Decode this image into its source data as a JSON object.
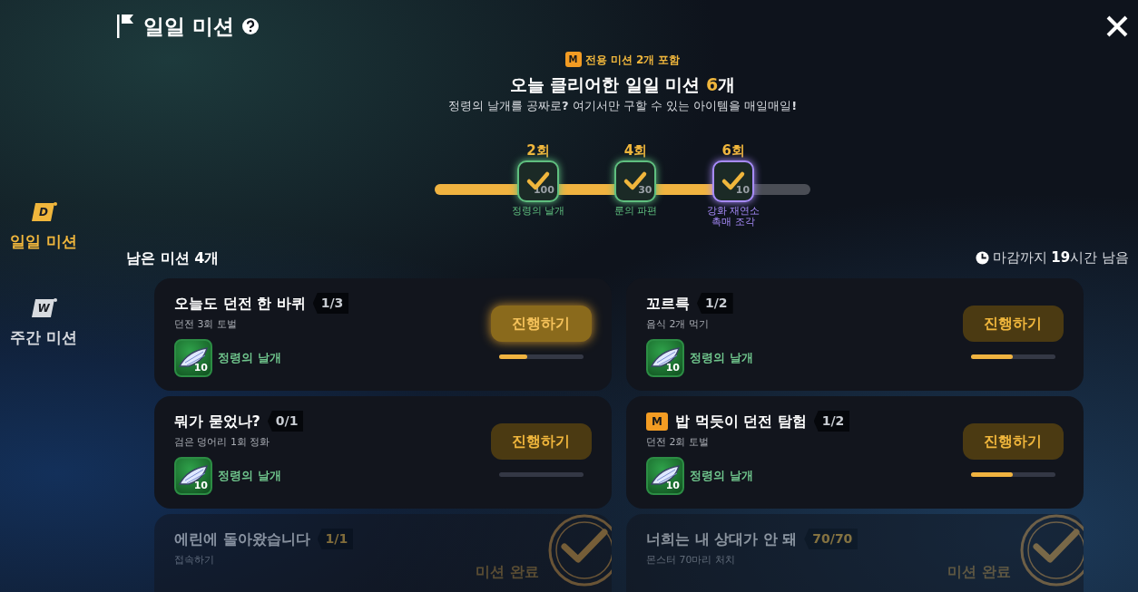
{
  "header": {
    "title": "일일 미션"
  },
  "sidebar": {
    "items": [
      {
        "label": "일일 미션",
        "letter": "D",
        "selected": true
      },
      {
        "label": "주간 미션",
        "letter": "W",
        "selected": false
      }
    ]
  },
  "summary": {
    "badge": "M",
    "note": "전용 미션 2개 포함",
    "title": "오늘 클리어한 일일 미션 **6**개",
    "subtitle": "정령의 날개를 공짜로**?** 여기서만 구할 수 있는 아이템을 매일매일**!**",
    "level": 0.76,
    "milestones": [
      {
        "label": "2회",
        "count": "100",
        "reward": "정령의 날개",
        "color": "#5fbf7f",
        "claimed": true
      },
      {
        "label": "4회",
        "count": "30",
        "reward": "룬의 파편",
        "color": "#5fbf7f",
        "claimed": true
      },
      {
        "label": "6회",
        "count": "10",
        "reward": "강화 재연소 촉매 조각",
        "color": "#a78bfa",
        "claimed": true
      }
    ]
  },
  "remaining": "남은 미션 4개",
  "deadline": "마감까지 **19**시간 남음",
  "missions": [
    {
      "title": "오늘도 던전 한 바퀴",
      "progress": "1/3",
      "desc": "던전 3회 토벌",
      "reward": "정령의 날개",
      "count": "10",
      "button": "진행하기",
      "level": 0.34,
      "exclusive": false,
      "glow": true,
      "completed": false
    },
    {
      "title": "꼬르륵",
      "progress": "1/2",
      "desc": "음식 2개 먹기",
      "reward": "정령의 날개",
      "count": "10",
      "button": "진행하기",
      "level": 0.5,
      "exclusive": false,
      "glow": false,
      "completed": false
    },
    {
      "title": "뭐가 묻었나?",
      "progress": "0/1",
      "desc": "검은 덩어리 1회 정화",
      "reward": "정령의 날개",
      "count": "10",
      "button": "진행하기",
      "level": 0,
      "exclusive": false,
      "glow": false,
      "completed": false
    },
    {
      "badge": "M",
      "title": "밥 먹듯이 던전 탐험",
      "progress": "1/2",
      "desc": "던전 2회 토벌",
      "reward": "정령의 날개",
      "count": "10",
      "button": "진행하기",
      "level": 0.5,
      "exclusive": true,
      "glow": false,
      "completed": false
    },
    {
      "title": "에린에 돌아왔습니다",
      "progress": "1/1",
      "desc": "접속하기",
      "status": "미션 완료",
      "exclusive": false,
      "completed": true
    },
    {
      "title": "너희는 내 상대가 안 돼",
      "progress": "70/70",
      "desc": "몬스터 70마리 처치",
      "status": "미션 완료",
      "exclusive": false,
      "completed": true
    }
  ]
}
